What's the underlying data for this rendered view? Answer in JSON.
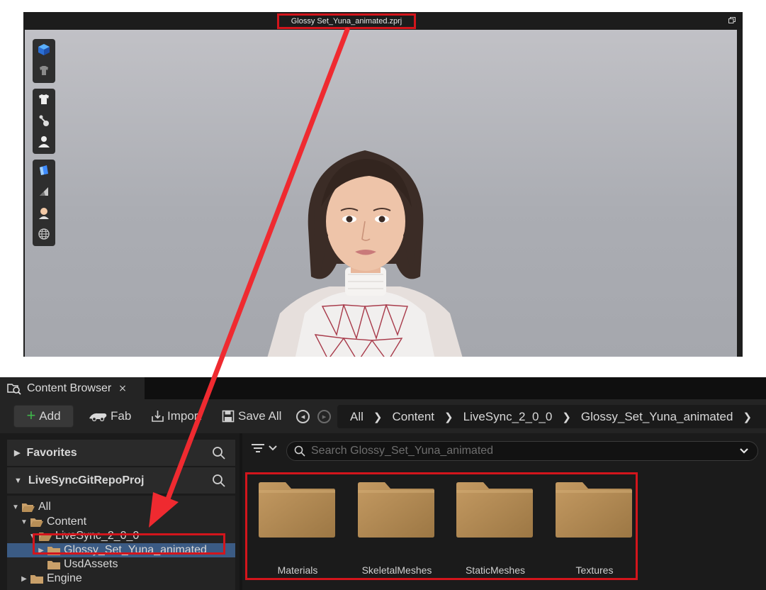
{
  "viewport": {
    "title": "Glossy Set_Yuna_animated.zprj"
  },
  "content_browser": {
    "tab_label": "Content Browser",
    "tab_close": "×",
    "toolbar": {
      "add_label": "Add",
      "fab_label": "Fab",
      "import_label": "Import",
      "save_all_label": "Save All"
    },
    "breadcrumb": [
      "All",
      "Content",
      "LiveSync_2_0_0",
      "Glossy_Set_Yuna_animated"
    ],
    "favorites_label": "Favorites",
    "project_label": "LiveSyncGitRepoProj",
    "tree": [
      {
        "label": "All"
      },
      {
        "label": "Content"
      },
      {
        "label": "LiveSync_2_0_0"
      },
      {
        "label": "Glossy_Set_Yuna_animated"
      },
      {
        "label": "UsdAssets"
      },
      {
        "label": "Engine"
      }
    ],
    "search_placeholder": "Search Glossy_Set_Yuna_animated",
    "folders": [
      {
        "label": "Materials"
      },
      {
        "label": "SkeletalMeshes"
      },
      {
        "label": "StaticMeshes"
      },
      {
        "label": "Textures"
      }
    ],
    "colors": {
      "highlight_red": "#d3151c",
      "folder_tan": "#b08a55",
      "selection_blue": "#3b5b84",
      "add_green": "#3fb54a"
    }
  }
}
